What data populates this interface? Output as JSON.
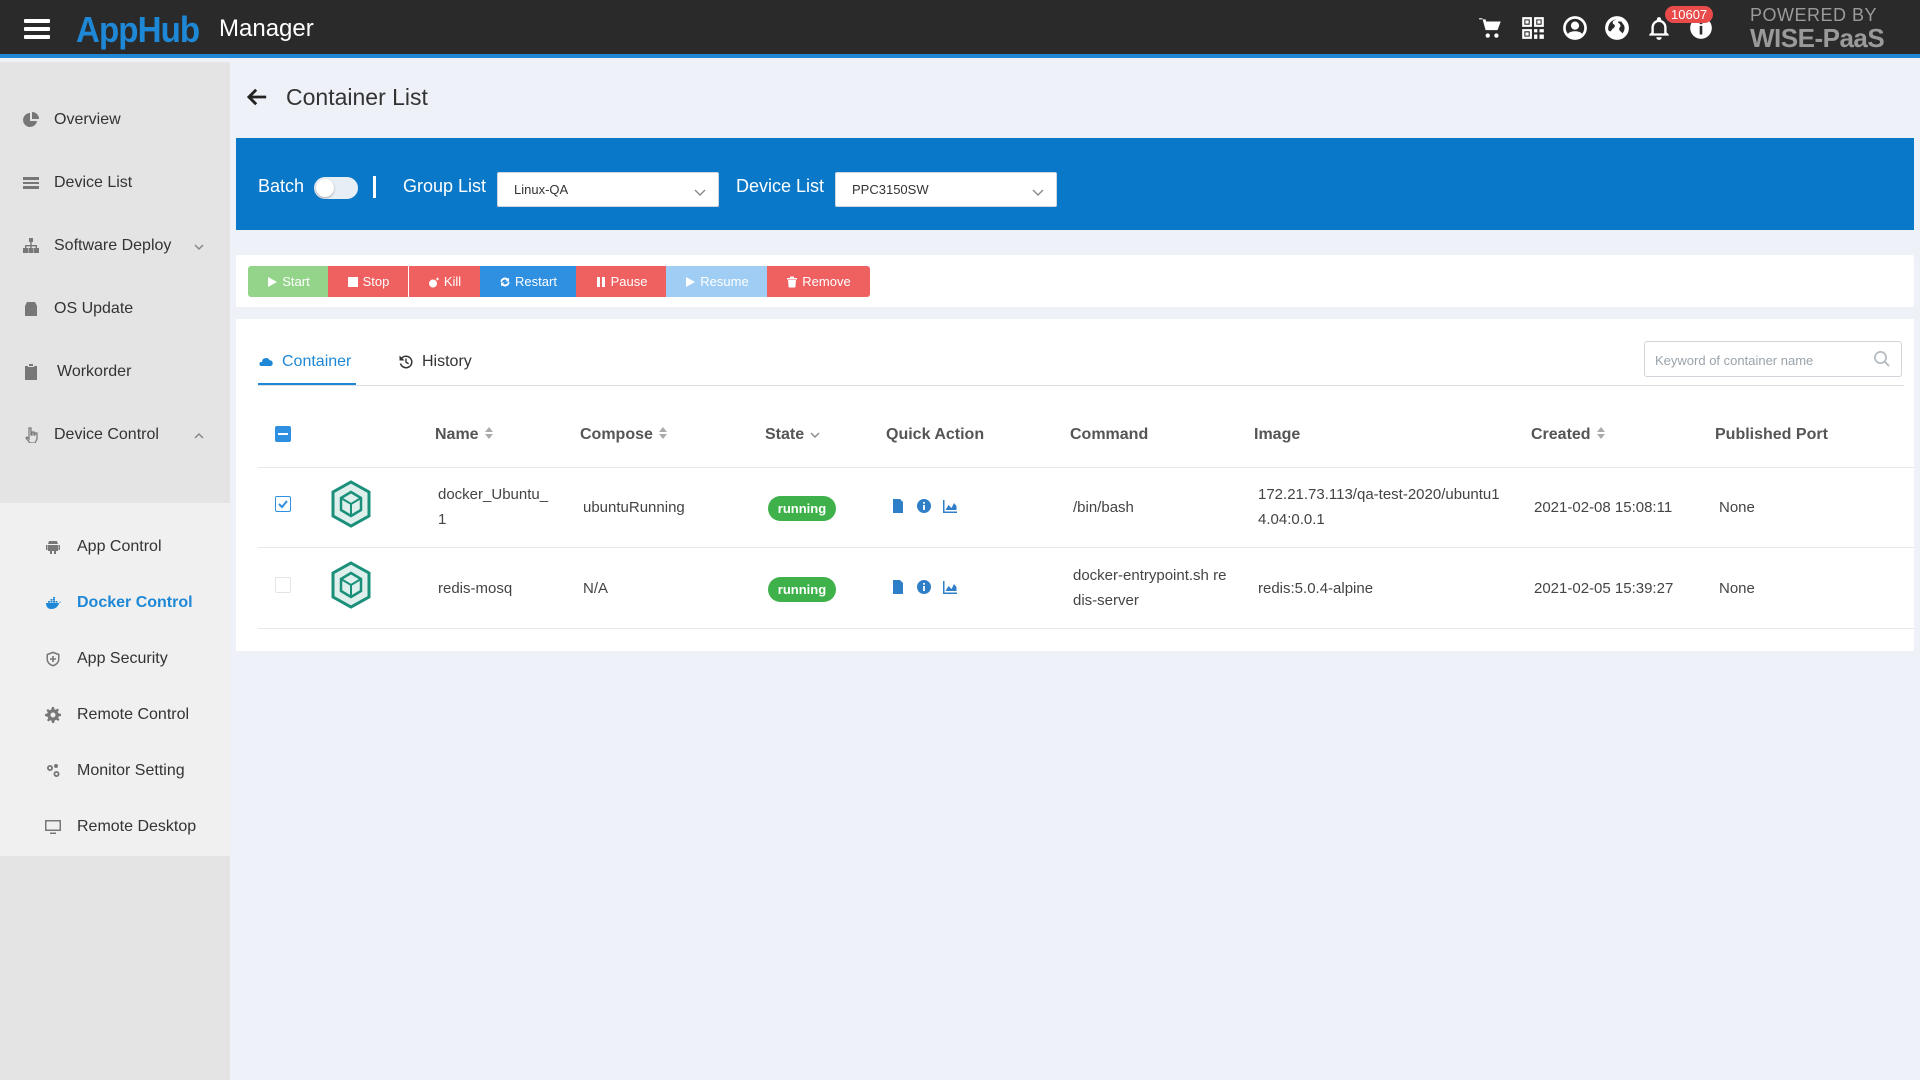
{
  "header": {
    "logo": "AppHub",
    "title": "Manager",
    "notification_count": "10607",
    "powered_line1": "POWERED BY",
    "powered_line2": "WISE-PaaS"
  },
  "sidebar": {
    "items": [
      {
        "label": "Overview",
        "icon": "pie-chart-icon"
      },
      {
        "label": "Device List",
        "icon": "list-icon"
      },
      {
        "label": "Software Deploy",
        "icon": "sitemap-icon"
      },
      {
        "label": "OS Update",
        "icon": "package-icon"
      },
      {
        "label": "Workorder",
        "icon": "clipboard-icon"
      },
      {
        "label": "Device Control",
        "icon": "hand-pointer-icon"
      }
    ],
    "submenu": [
      {
        "label": "App Control",
        "icon": "android-icon"
      },
      {
        "label": "Docker Control",
        "icon": "docker-icon",
        "active": true
      },
      {
        "label": "App Security",
        "icon": "shield-icon"
      },
      {
        "label": "Remote Control",
        "icon": "gear-icon"
      },
      {
        "label": "Monitor Setting",
        "icon": "gears-icon"
      },
      {
        "label": "Remote Desktop",
        "icon": "monitor-icon"
      }
    ]
  },
  "page": {
    "title": "Container List"
  },
  "filters": {
    "batch_label": "Batch",
    "batch_enabled": false,
    "group_label": "Group List",
    "group_value": "Linux-QA",
    "device_label": "Device List",
    "device_value": "PPC3150SW"
  },
  "actions": {
    "start": "Start",
    "stop": "Stop",
    "kill": "Kill",
    "restart": "Restart",
    "pause": "Pause",
    "resume": "Resume",
    "remove": "Remove"
  },
  "tabs": {
    "container": "Container",
    "history": "History"
  },
  "search": {
    "placeholder": "Keyword of container name"
  },
  "table": {
    "columns": {
      "name": "Name",
      "compose": "Compose",
      "state": "State",
      "quick_action": "Quick Action",
      "command": "Command",
      "image": "Image",
      "created": "Created",
      "published_port": "Published Port"
    },
    "rows": [
      {
        "checked": true,
        "name_line1": "docker_Ubuntu_",
        "name_line2": "1",
        "compose": "ubuntuRunning",
        "state": "running",
        "command_line1": "/bin/bash",
        "command_line2": "",
        "image_line1": "172.21.73.113/qa-test-2020/ubuntu1",
        "image_line2": "4.04:0.0.1",
        "created": "2021-02-08 15:08:11",
        "port": "None"
      },
      {
        "checked": false,
        "name_line1": "redis-mosq",
        "name_line2": "",
        "compose": "N/A",
        "state": "running",
        "command_line1": "docker-entrypoint.sh re",
        "command_line2": "dis-server",
        "image_line1": "redis:5.0.4-alpine",
        "image_line2": "",
        "created": "2021-02-05 15:39:27",
        "port": "None"
      }
    ]
  },
  "colors": {
    "brand": "#1e88d6",
    "topbar": "#2a2a2a",
    "filterbar": "#0a78c8",
    "running": "#3fb14a",
    "danger": "#ef6060"
  }
}
